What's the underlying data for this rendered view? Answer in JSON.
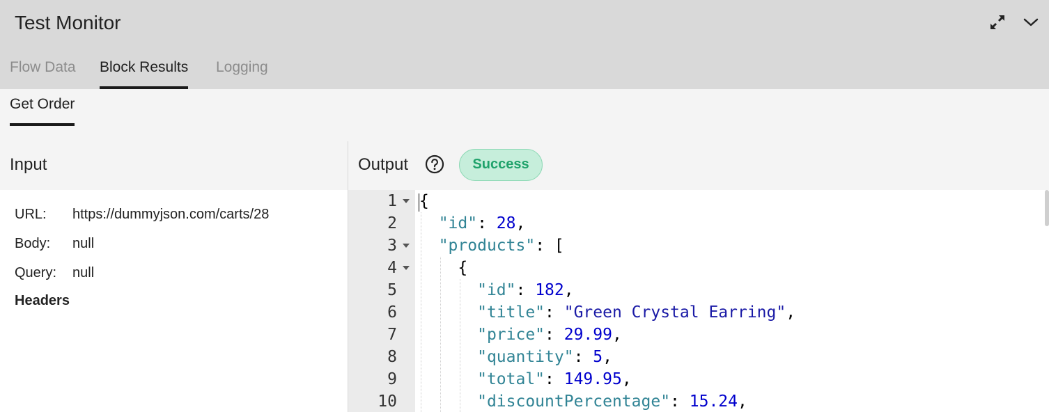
{
  "header": {
    "title": "Test Monitor",
    "icons": [
      "expand-icon",
      "chevron-down-icon"
    ],
    "tabs": [
      {
        "label": "Flow Data",
        "active": false
      },
      {
        "label": "Block Results",
        "active": true
      },
      {
        "label": "Logging",
        "active": false
      }
    ]
  },
  "subtabs": [
    {
      "label": "Get Order",
      "active": true
    }
  ],
  "input": {
    "title": "Input",
    "fields": [
      {
        "key": "URL:",
        "value": "https://dummyjson.com/carts/28"
      },
      {
        "key": "Body:",
        "value": "null"
      },
      {
        "key": "Query:",
        "value": "null"
      }
    ],
    "headers_label": "Headers"
  },
  "output": {
    "title": "Output",
    "status": "Success",
    "status_color": "#1fa26b",
    "line_numbers": [
      "1",
      "2",
      "3",
      "4",
      "5",
      "6",
      "7",
      "8",
      "9",
      "10"
    ],
    "code": {
      "l1": "{",
      "l2_key": "\"id\"",
      "l2_val": "28",
      "l3_key": "\"products\"",
      "l3_val": "[",
      "l4": "{",
      "l5_key": "\"id\"",
      "l5_val": "182",
      "l6_key": "\"title\"",
      "l6_val": "\"Green Crystal Earring\"",
      "l7_key": "\"price\"",
      "l7_val": "29.99",
      "l8_key": "\"quantity\"",
      "l8_val": "5",
      "l9_key": "\"total\"",
      "l9_val": "149.95",
      "l10_key": "\"discountPercentage\"",
      "l10_val": "15.24"
    }
  }
}
